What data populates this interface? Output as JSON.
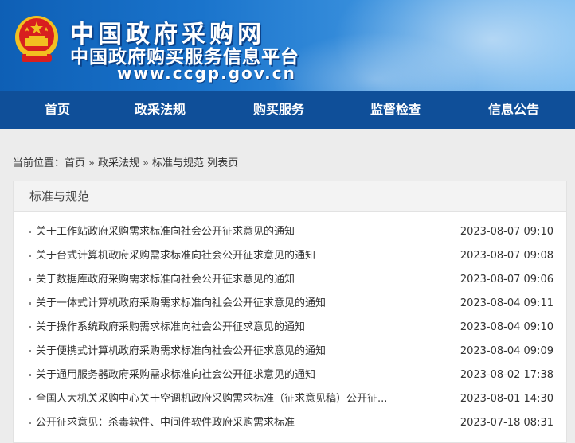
{
  "header": {
    "title_main": "中国政府采购网",
    "title_sub": "中国政府购买服务信息平台",
    "url": "www.ccgp.gov.cn",
    "colors": {
      "header_blue": "#1a74cc",
      "nav_blue": "#0f4f99",
      "emblem_red": "#d81f1f",
      "emblem_gold": "#f2c020"
    }
  },
  "nav": {
    "items": [
      "首页",
      "政采法规",
      "购买服务",
      "监督检查",
      "信息公告"
    ]
  },
  "breadcrumb": {
    "prefix": "当前位置：",
    "home": "首页",
    "sep": "»",
    "level1": "政采法规",
    "level2": "标准与规范 列表页"
  },
  "panel": {
    "title": "标准与规范",
    "items": [
      {
        "title": "关于工作站政府采购需求标准向社会公开征求意见的通知",
        "date": "2023-08-07 09:10"
      },
      {
        "title": "关于台式计算机政府采购需求标准向社会公开征求意见的通知",
        "date": "2023-08-07 09:08"
      },
      {
        "title": "关于数据库政府采购需求标准向社会公开征求意见的通知",
        "date": "2023-08-07 09:06"
      },
      {
        "title": "关于一体式计算机政府采购需求标准向社会公开征求意见的通知",
        "date": "2023-08-04 09:11"
      },
      {
        "title": "关于操作系统政府采购需求标准向社会公开征求意见的通知",
        "date": "2023-08-04 09:10"
      },
      {
        "title": "关于便携式计算机政府采购需求标准向社会公开征求意见的通知",
        "date": "2023-08-04 09:09"
      },
      {
        "title": "关于通用服务器政府采购需求标准向社会公开征求意见的通知",
        "date": "2023-08-02 17:38"
      },
      {
        "title": "全国人大机关采购中心关于空调机政府采购需求标准（征求意见稿）公开征...",
        "date": "2023-08-01 14:30"
      },
      {
        "title": "公开征求意见：杀毒软件、中间件软件政府采购需求标准",
        "date": "2023-07-18 08:31"
      }
    ]
  }
}
